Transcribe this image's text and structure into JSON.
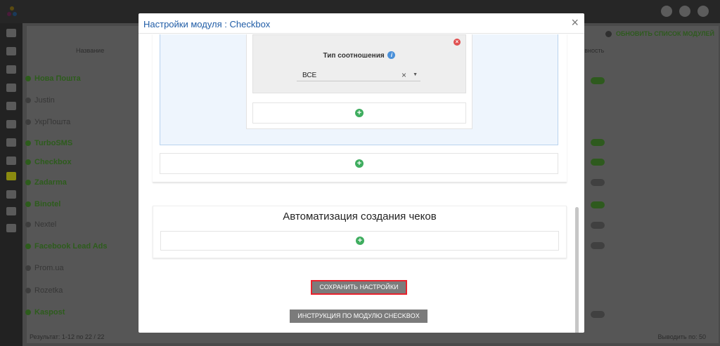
{
  "background_app": {
    "update_button_label": "ОБНОВИТЬ СПИСОК МОДУЛЕЙ",
    "column_name_header": "Название",
    "column_activity_header": "Активность",
    "modules": [
      {
        "name": "Нова Пошта",
        "active": true
      },
      {
        "name": "Justin",
        "active": false
      },
      {
        "name": "УкрПошта",
        "active": false
      },
      {
        "name": "TurboSMS",
        "active": true
      },
      {
        "name": "Checkbox",
        "active": true
      },
      {
        "name": "Zadarma",
        "active": true
      },
      {
        "name": "Binotel",
        "active": true
      },
      {
        "name": "Nextel",
        "active": false
      },
      {
        "name": "Facebook Lead Ads",
        "active": true
      },
      {
        "name": "Prom.ua",
        "active": false
      },
      {
        "name": "Rozetka",
        "active": false
      },
      {
        "name": "Kaspost",
        "active": true
      }
    ],
    "footer_result": "Результат: 1-12 по 22 / 22",
    "footer_per_page": "Выводить по: 50"
  },
  "modal": {
    "title": "Настройки модуля : Checkbox",
    "close_glyph": "×",
    "relation": {
      "label": "Тип соотношения",
      "info_glyph": "i",
      "remove_glyph": "×",
      "select_value": "ВСЕ",
      "clear_glyph": "×",
      "arrow_glyph": "▼"
    },
    "plus_glyph": "+",
    "automation_title": "Автоматизация создания чеков",
    "save_button_label": "СОХРАНИТЬ НАСТРОЙКИ",
    "guide_button_label": "ИНСТРУКЦИЯ ПО МОДУЛЮ CHECKBOX"
  },
  "colors": {
    "title_blue": "#1f5ca6",
    "add_green": "#3fad5f",
    "remove_red": "#e05050",
    "save_highlight": "#e8222c",
    "button_gray": "#7b7b7b"
  }
}
